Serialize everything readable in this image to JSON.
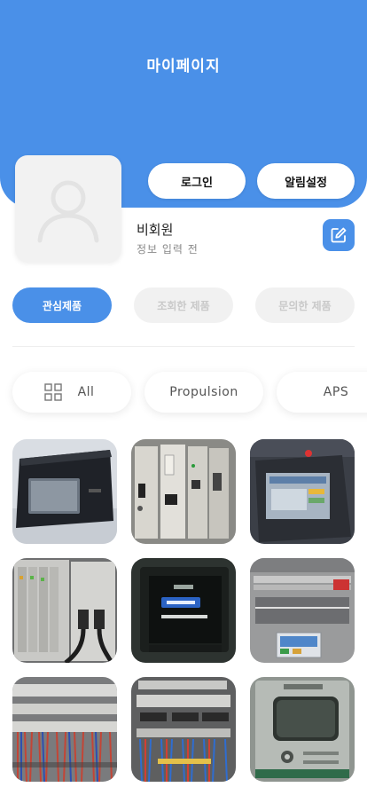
{
  "header": {
    "title": "마이페이지"
  },
  "actions": {
    "login_label": "로그인",
    "alarm_label": "알림설정"
  },
  "user": {
    "name": "비회원",
    "status": "정보 입력 전"
  },
  "segments": [
    {
      "label": "관심제품",
      "active": true
    },
    {
      "label": "조회한 제품",
      "active": false
    },
    {
      "label": "문의한 제품",
      "active": false
    }
  ],
  "filters": [
    {
      "label": "All",
      "icon": "grid-icon"
    },
    {
      "label": "Propulsion"
    },
    {
      "label": "APS"
    }
  ],
  "colors": {
    "primary": "#4a90e8",
    "inactive_bg": "#f1f1f1",
    "inactive_text": "#c9c9c9"
  },
  "products": [
    {
      "screen_text": []
    },
    {
      "screen_text": []
    },
    {
      "screen_text": []
    },
    {
      "screen_text": []
    },
    {
      "screen_text": []
    },
    {
      "screen_text": []
    },
    {
      "screen_text": []
    },
    {
      "screen_text": []
    },
    {
      "screen_text": []
    }
  ]
}
